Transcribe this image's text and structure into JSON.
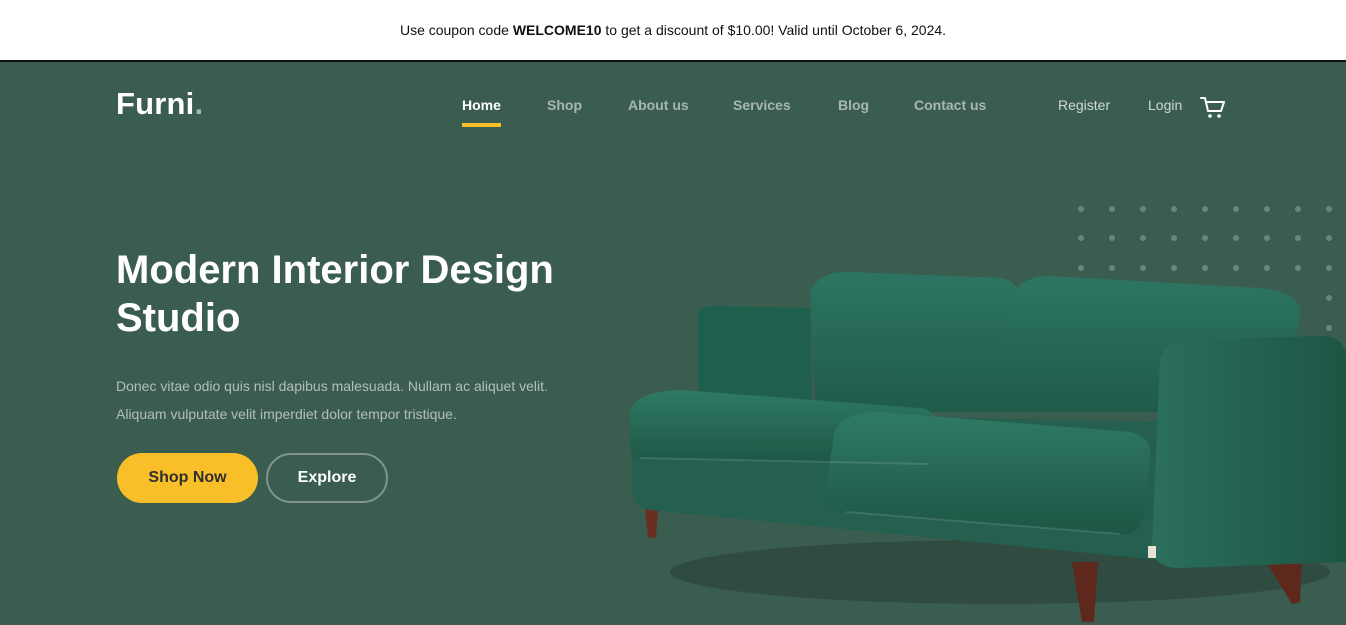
{
  "announcement": {
    "prefix": "Use coupon code ",
    "code": "WELCOME10",
    "suffix": " to get a discount of $10.00! Valid until October 6, 2024."
  },
  "brand": {
    "name": "Furni",
    "dot": "."
  },
  "nav": {
    "items": [
      {
        "label": "Home",
        "active": true
      },
      {
        "label": "Shop"
      },
      {
        "label": "About us"
      },
      {
        "label": "Services"
      },
      {
        "label": "Blog"
      },
      {
        "label": "Contact us"
      }
    ],
    "register": "Register",
    "login": "Login",
    "cart_icon": "cart-icon"
  },
  "hero": {
    "title": "Modern Interior Design Studio",
    "description": "Donec vitae odio quis nisl dapibus malesuada. Nullam ac aliquet velit. Aliquam vulputate velit imperdiet dolor tempor tristique.",
    "primary_button": "Shop Now",
    "secondary_button": "Explore"
  },
  "colors": {
    "background": "#3b5d50",
    "accent": "#f9bf29",
    "announcement_bg": "#ffffff"
  }
}
